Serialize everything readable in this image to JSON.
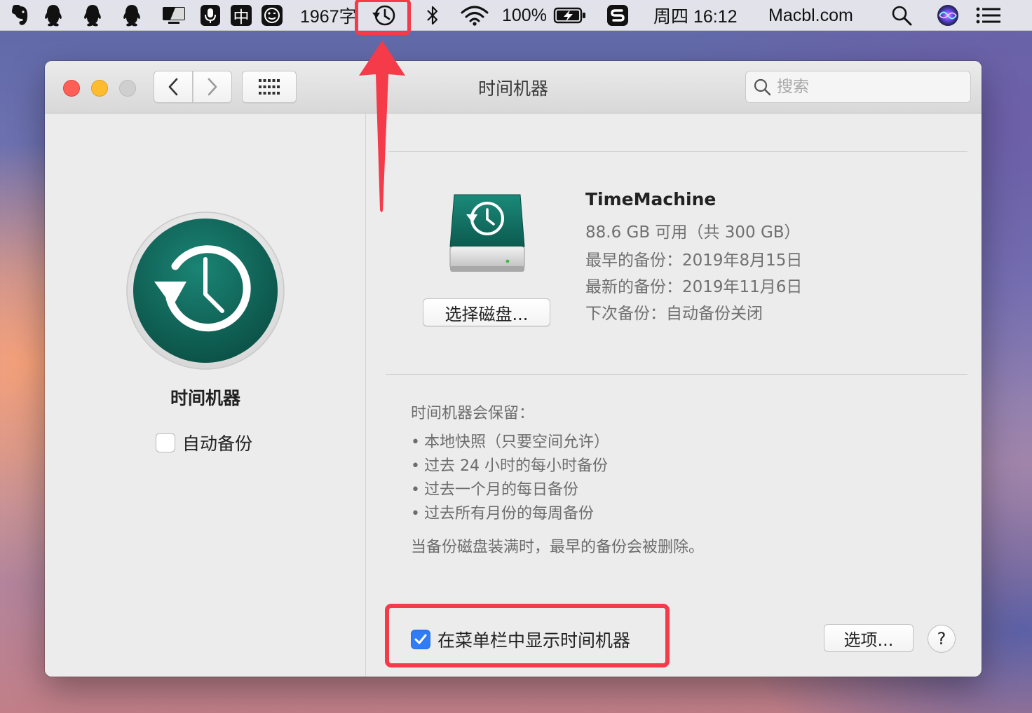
{
  "menubar": {
    "icons": [
      "evernote-icon",
      "qq-icon",
      "qq-icon",
      "qq-icon",
      "airplay-icon",
      "microphone-icon",
      "input-method-icon",
      "emoji-icon"
    ],
    "input_method": "中",
    "word_count": "1967字",
    "battery": "100%",
    "datetime": "周四 16:12",
    "site": "Macbl.com"
  },
  "window": {
    "title": "时间机器",
    "search_placeholder": "搜索"
  },
  "left": {
    "title": "时间机器",
    "auto_backup_label": "自动备份",
    "auto_backup_checked": false
  },
  "disk": {
    "name": "TimeMachine",
    "available": "88.6 GB 可用（共 300 GB）",
    "oldest": "最早的备份：2019年8月15日",
    "latest": "最新的备份：2019年11月6日",
    "next": "下次备份：自动备份关闭",
    "select_button": "选择磁盘..."
  },
  "retention": {
    "title": "时间机器会保留：",
    "items": [
      "本地快照（只要空间允许）",
      "过去 24 小时的每小时备份",
      "过去一个月的每日备份",
      "过去所有月份的每周备份"
    ],
    "note": "当备份磁盘装满时，最早的备份会被删除。"
  },
  "footer": {
    "show_in_menubar_label": "在菜单栏中显示时间机器",
    "show_in_menubar_checked": true,
    "options_button": "选项...",
    "help_button": "?"
  },
  "colors": {
    "teal": "#0f6a5c",
    "annotation_red": "#f53a4a",
    "checkbox_blue": "#2f7cf6"
  }
}
